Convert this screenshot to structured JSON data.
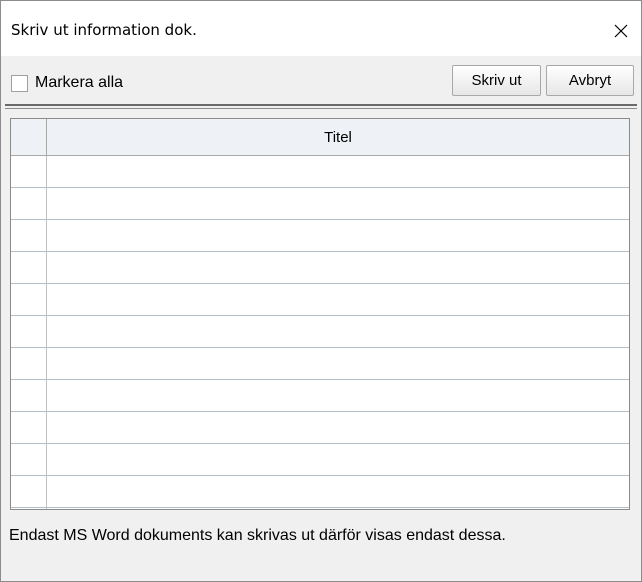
{
  "window": {
    "title": "Skriv ut information dok."
  },
  "toolbar": {
    "select_all_label": "Markera alla",
    "select_all_checked": false,
    "print_label": "Skriv ut",
    "cancel_label": "Avbryt"
  },
  "table": {
    "columns": [
      "",
      "Titel"
    ],
    "rows": [
      [
        "",
        ""
      ],
      [
        "",
        ""
      ],
      [
        "",
        ""
      ],
      [
        "",
        ""
      ],
      [
        "",
        ""
      ],
      [
        "",
        ""
      ],
      [
        "",
        ""
      ],
      [
        "",
        ""
      ],
      [
        "",
        ""
      ],
      [
        "",
        ""
      ],
      [
        "",
        ""
      ],
      [
        "",
        ""
      ]
    ]
  },
  "footer": {
    "note": "Endast MS Word dokuments kan skrivas ut därför visas endast dessa."
  },
  "icons": {
    "close": "close-icon"
  }
}
